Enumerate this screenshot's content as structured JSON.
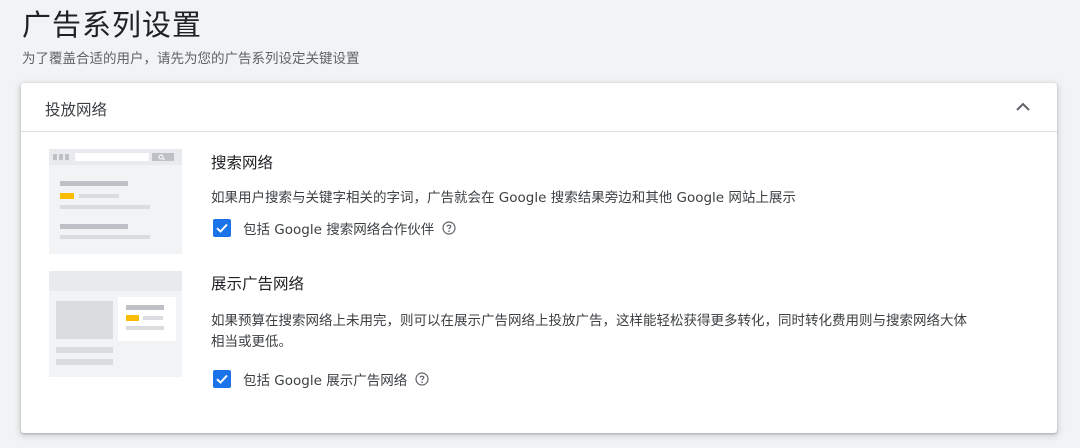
{
  "page": {
    "title": "广告系列设置",
    "subtitle": "为了覆盖合适的用户，请先为您的广告系列设定关键设置"
  },
  "card": {
    "title": "投放网络",
    "collapse_icon": "chevron-up-icon"
  },
  "search_network": {
    "heading": "搜索网络",
    "description": "如果用户搜索与关键字相关的字词，广告就会在 Google 搜索结果旁边和其他 Google 网站上展示",
    "checkbox_label": "包括 Google 搜索网络合作伙伴",
    "checked": true,
    "help_icon": "help-circle-icon"
  },
  "display_network": {
    "heading": "展示广告网络",
    "description_line1": "如果预算在搜索网络上未用完，则可以在展示广告网络上投放广告，这样能轻松获得更多转化，同时转化费用则与搜索网络大体",
    "description_line2": "相当或更低。",
    "checkbox_label": "包括 Google 展示广告网络",
    "checked": true,
    "help_icon": "help-circle-icon"
  },
  "colors": {
    "accent": "#1a73e8",
    "highlight": "#fbbc04",
    "placeholder": "#dadce0"
  }
}
